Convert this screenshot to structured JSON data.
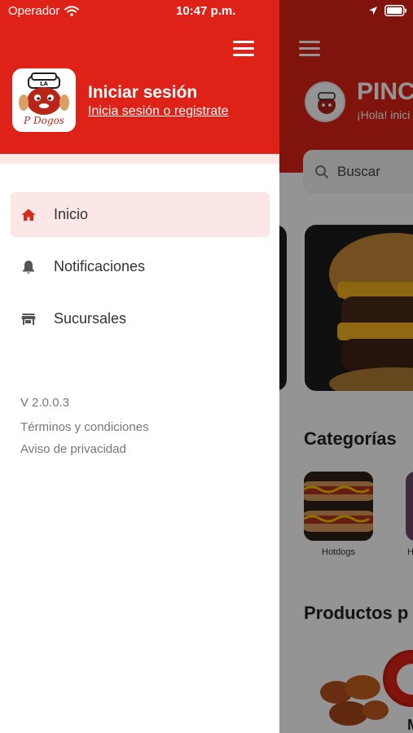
{
  "status_bar": {
    "carrier": "Operador",
    "time": "10:47 p.m."
  },
  "drawer": {
    "login_title": "Iniciar sesión",
    "login_subtitle": "Inicia sesión o registrate",
    "logo_text": "P Dogos",
    "nav_items": [
      {
        "label": "Inicio",
        "icon": "home-icon",
        "active": true
      },
      {
        "label": "Notificaciones",
        "icon": "bell-icon",
        "active": false
      },
      {
        "label": "Sucursales",
        "icon": "store-icon",
        "active": false
      }
    ],
    "version": "V 2.0.0.3",
    "terms": "Términos y condiciones",
    "privacy": "Aviso de privacidad"
  },
  "background_app": {
    "title": "PINC",
    "greeting": "¡Hola! inici",
    "search_placeholder": "Buscar",
    "categories_title": "Categorías",
    "categories": [
      {
        "label": "Hotdogs"
      },
      {
        "label": "H"
      }
    ],
    "products_title": "Productos p",
    "product_letter": "M"
  },
  "colors": {
    "brand_red": "#df2217",
    "active_item_bg": "#fbe8e6",
    "text_dark": "#333333",
    "text_muted": "#777777"
  }
}
